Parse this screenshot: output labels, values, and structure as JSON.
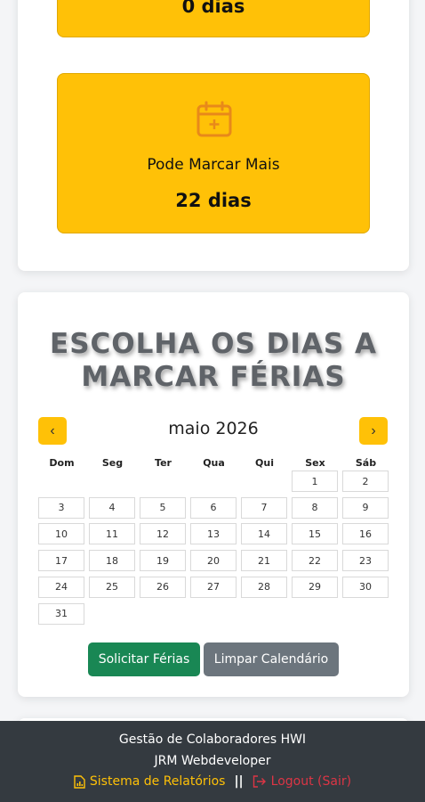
{
  "stats": {
    "first_value": "0 dias",
    "second_label": "Pode Marcar Mais",
    "second_value": "22 dias",
    "icon": "calendar-plus-icon"
  },
  "calendar": {
    "heading_line1": "ESCOLHA OS DIAS A",
    "heading_line2": "MARCAR FÉRIAS",
    "month_label": "maio 2026",
    "prev_icon": "‹",
    "next_icon": "›",
    "weekdays": [
      "Dom",
      "Seg",
      "Ter",
      "Qua",
      "Qui",
      "Sex",
      "Sáb"
    ],
    "first_weekday_index": 5,
    "days": [
      "1",
      "2",
      "3",
      "4",
      "5",
      "6",
      "7",
      "8",
      "9",
      "10",
      "11",
      "12",
      "13",
      "14",
      "15",
      "16",
      "17",
      "18",
      "19",
      "20",
      "21",
      "22",
      "23",
      "24",
      "25",
      "26",
      "27",
      "28",
      "29",
      "30",
      "31"
    ]
  },
  "actions": {
    "request_label": "Solicitar Férias",
    "clear_label": "Limpar Calendário"
  },
  "footer": {
    "line1": "Gestão de Colaboradores HWI",
    "line2": "JRM Webdeveloper",
    "reports_label": "Sistema de Relatórios",
    "separator": "||",
    "logout_label": "Logout (Sair)"
  },
  "colors": {
    "accent": "#ffc107",
    "success": "#198754",
    "secondary": "#6c757d",
    "danger": "#dc3545",
    "footer_bg": "#343a40"
  }
}
